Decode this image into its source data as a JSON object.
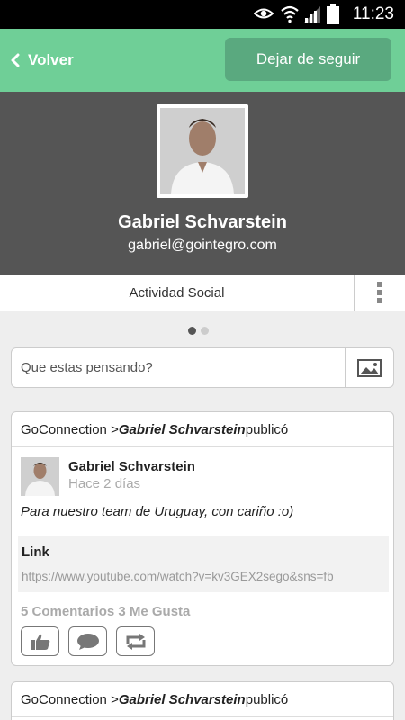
{
  "status_bar": {
    "time": "11:23",
    "icons": [
      "eye-icon",
      "wifi-icon",
      "signal-icon",
      "battery-icon"
    ]
  },
  "top_bar": {
    "back_label": "Volver",
    "unfollow_label": "Dejar de seguir",
    "accent_color": "#6fcf97"
  },
  "profile": {
    "name": "Gabriel Schvarstein",
    "email": "gabriel@gointegro.com"
  },
  "tabs": {
    "active_label": "Actividad Social",
    "more_icon": "more-vertical-icon"
  },
  "pager": {
    "pages": 2,
    "active": 1
  },
  "composer": {
    "placeholder": "Que estas pensando?",
    "image_icon": "image-icon"
  },
  "posts": [
    {
      "source": "GoConnection > ",
      "author_bold": "Gabriel Schvarstein",
      "verb": " publicó",
      "author_name": "Gabriel Schvarstein",
      "time": "Hace 2 días",
      "text": "Para nuestro team de Uruguay, con cariño :o)",
      "link_title": "Link",
      "link_url": "https://www.youtube.com/watch?v=kv3GEX2sego&sns=fb",
      "stats": "5 Comentarios 3 Me Gusta",
      "actions": [
        "like-icon",
        "comment-icon",
        "share-icon"
      ]
    },
    {
      "source": "GoConnection > ",
      "author_bold": "Gabriel Schvarstein",
      "verb": " publicó"
    }
  ]
}
